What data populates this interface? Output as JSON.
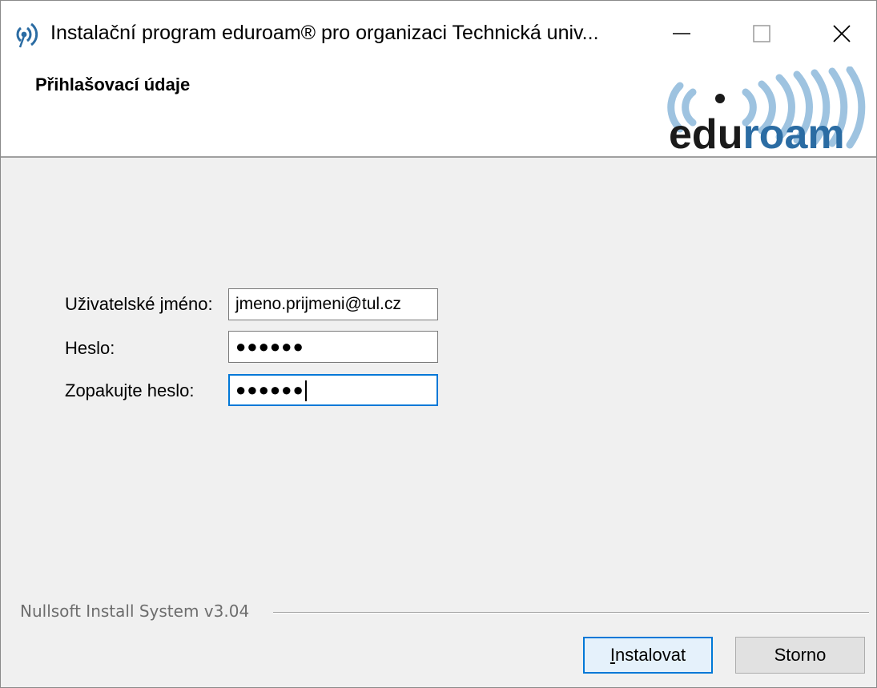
{
  "window": {
    "title": "Instalační program eduroam® pro organizaci Technická univ...",
    "icon": "eduroam-antenna-icon"
  },
  "header": {
    "title": "Přihlašovací údaje",
    "logo": {
      "text_dark": "ed",
      "text_dark2": "u",
      "text_light": "roam"
    }
  },
  "form": {
    "username_label": "Uživatelské jméno:",
    "username_value": "jmeno.prijmeni@tul.cz",
    "password_label": "Heslo:",
    "password_value": "●●●●●●",
    "repeat_label": "Zopakujte heslo:",
    "repeat_value": "●●●●●●"
  },
  "footer": {
    "branding": "Nullsoft Install System v3.04",
    "install_accel": "I",
    "install_rest": "nstalovat",
    "cancel_label": "Storno"
  },
  "colors": {
    "accent": "#0078d7",
    "logo_dark": "#1a1a1a",
    "logo_blue": "#2b6ca3",
    "logo_arcs": "#9ec3e0"
  }
}
